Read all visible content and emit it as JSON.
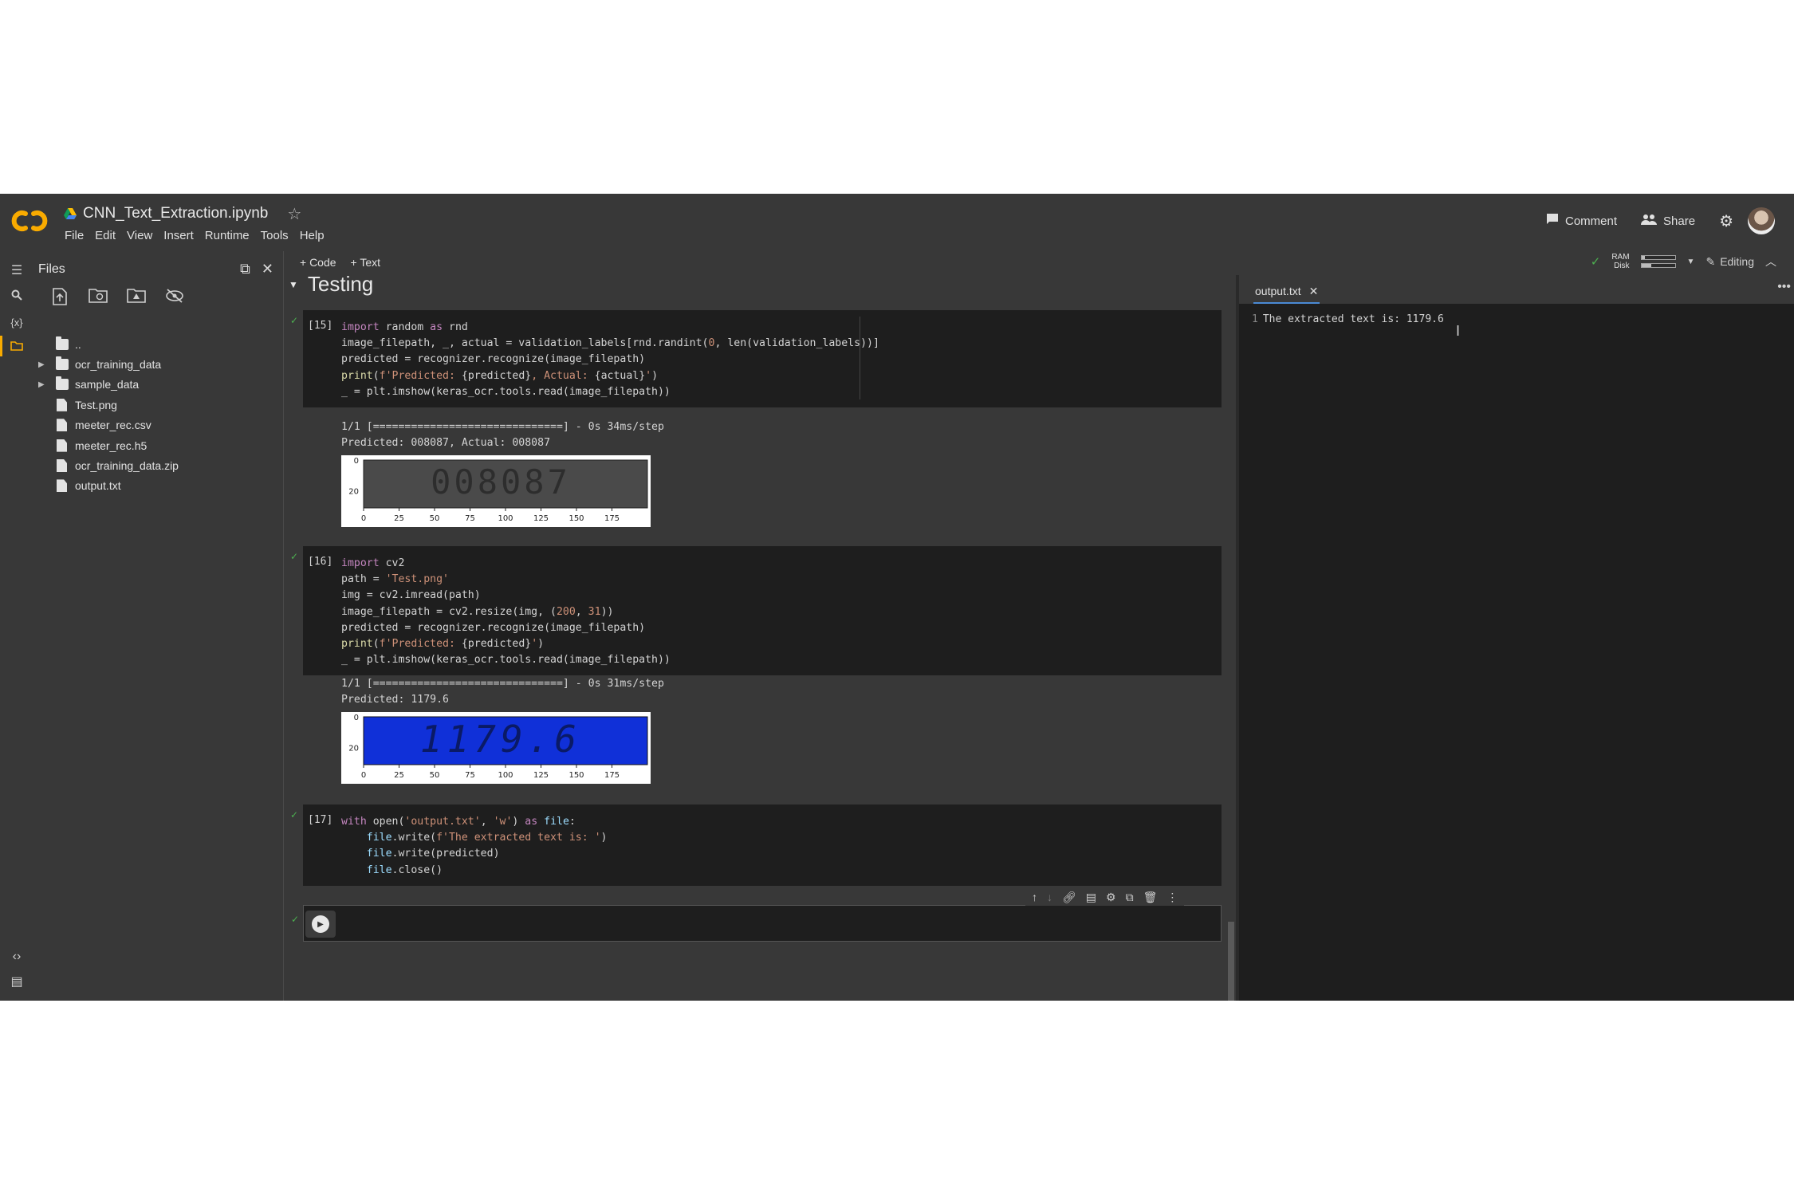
{
  "header": {
    "title": "CNN_Text_Extraction.ipynb",
    "menu": [
      "File",
      "Edit",
      "View",
      "Insert",
      "Runtime",
      "Tools",
      "Help"
    ],
    "comment_label": "Comment",
    "share_label": "Share"
  },
  "sidebar": {
    "title": "Files",
    "items": [
      {
        "name": "..",
        "type": "folder-up"
      },
      {
        "name": "ocr_training_data",
        "type": "folder"
      },
      {
        "name": "sample_data",
        "type": "folder"
      },
      {
        "name": "Test.png",
        "type": "file"
      },
      {
        "name": "meeter_rec.csv",
        "type": "file"
      },
      {
        "name": "meeter_rec.h5",
        "type": "file"
      },
      {
        "name": "ocr_training_data.zip",
        "type": "file"
      },
      {
        "name": "output.txt",
        "type": "file"
      }
    ]
  },
  "toolbar": {
    "code_label": "+ Code",
    "text_label": "+ Text",
    "ram_label": "RAM",
    "disk_label": "Disk",
    "ram_fill": 0.1,
    "disk_fill": 0.3,
    "editing_label": "Editing"
  },
  "notebook": {
    "section_title": "Testing",
    "cells": [
      {
        "exec": "[15]",
        "output_lines": [
          "1/1 [==============================] - 0s 34ms/step",
          "Predicted: 008087, Actual: 008087"
        ],
        "plot": {
          "yticks": [
            "0",
            "20"
          ],
          "xticks": [
            "0",
            "25",
            "50",
            "75",
            "100",
            "125",
            "150",
            "175"
          ],
          "image_text": "008087"
        }
      },
      {
        "exec": "[16]",
        "output_lines": [
          "1/1 [==============================] - 0s 31ms/step",
          "Predicted: 1179.6"
        ],
        "plot": {
          "yticks": [
            "0",
            "20"
          ],
          "xticks": [
            "0",
            "25",
            "50",
            "75",
            "100",
            "125",
            "150",
            "175"
          ],
          "image_text": "1179.6"
        }
      },
      {
        "exec": "[17]"
      }
    ]
  },
  "editor": {
    "tab_label": "output.txt",
    "line_number": "1",
    "line_text": "The extracted text is: 1179.6"
  }
}
